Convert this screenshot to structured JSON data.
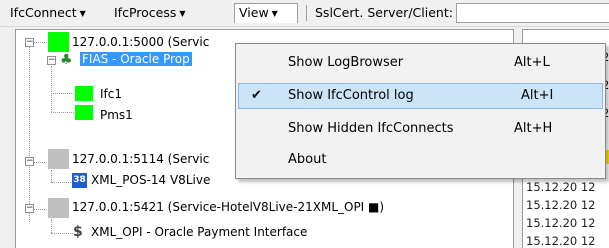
{
  "menubar": {
    "ifcconnect": "IfcConnect",
    "ifcprocess": "IfcProcess",
    "view": "View",
    "ssl_label": "SslCert. Server/Client:"
  },
  "view_menu": {
    "items": [
      {
        "label": "Show LogBrowser",
        "shortcut": "Alt+L",
        "checked": false
      },
      {
        "label": "Show IfcControl log",
        "shortcut": "Alt+I",
        "checked": true
      },
      {
        "label": "Show Hidden IfcConnects",
        "shortcut": "Alt+H",
        "checked": false
      },
      {
        "label": "About",
        "shortcut": "",
        "checked": false
      }
    ],
    "check_glyph": "✔"
  },
  "tree": {
    "nodes": [
      {
        "label": "127.0.0.1:5000 (Servic",
        "status": "green"
      },
      {
        "label": "FIAS - Oracle Prop",
        "selected": true
      },
      {
        "label": "Ifc1",
        "status": "green"
      },
      {
        "label": "Pms1",
        "status": "green"
      },
      {
        "label": "127.0.0.1:5114 (Servic",
        "status": "grey"
      },
      {
        "label": "XML_POS-14 V8Live",
        "icon": "xml-pos-icon"
      },
      {
        "label": "127.0.0.1:5421 (Service-HotelV8Live-21XML_OPI ■)",
        "status": "grey"
      },
      {
        "label": "XML_OPI - Oracle Payment Interface",
        "icon": "opi-icon"
      }
    ]
  },
  "log": {
    "lines": [
      "15.12.20 12",
      "15.12.20 12",
      "15.12.20 12",
      "15.12.20 12"
    ],
    "partial": [
      "2",
      "2",
      "2"
    ]
  },
  "colors": {
    "status_green": "#00ff00",
    "status_grey": "#c0c0c0",
    "selection": "#3399ff",
    "menu_highlight": "#cce4f7"
  }
}
